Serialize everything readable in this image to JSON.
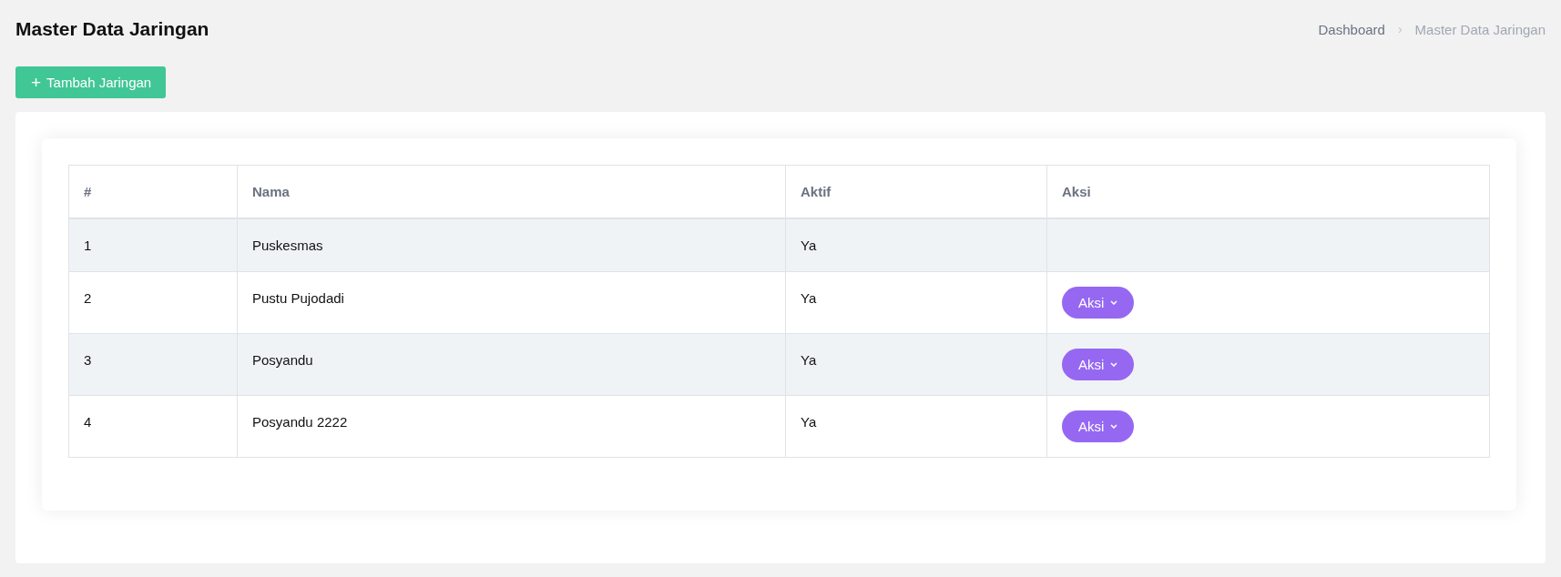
{
  "page": {
    "title": "Master Data Jaringan"
  },
  "breadcrumb": [
    {
      "label": "Dashboard",
      "current": false
    },
    {
      "label": "Master Data Jaringan",
      "current": true
    }
  ],
  "breadcrumb_separator": "›",
  "add_button": {
    "label": "Tambah Jaringan",
    "icon": "+"
  },
  "table": {
    "columns": [
      "#",
      "Nama",
      "Aktif",
      "Aksi"
    ],
    "rows": [
      {
        "no": "1",
        "name": "Puskesmas",
        "active": "Ya"
      },
      {
        "no": "2",
        "name": "Pustu Pujodadi",
        "active": "Ya",
        "action": "Aksi"
      },
      {
        "no": "3",
        "name": "Posyandu",
        "active": "Ya",
        "action": "Aksi"
      },
      {
        "no": "4",
        "name": "Posyandu 2222",
        "active": "Ya",
        "action": "Aksi"
      }
    ]
  }
}
